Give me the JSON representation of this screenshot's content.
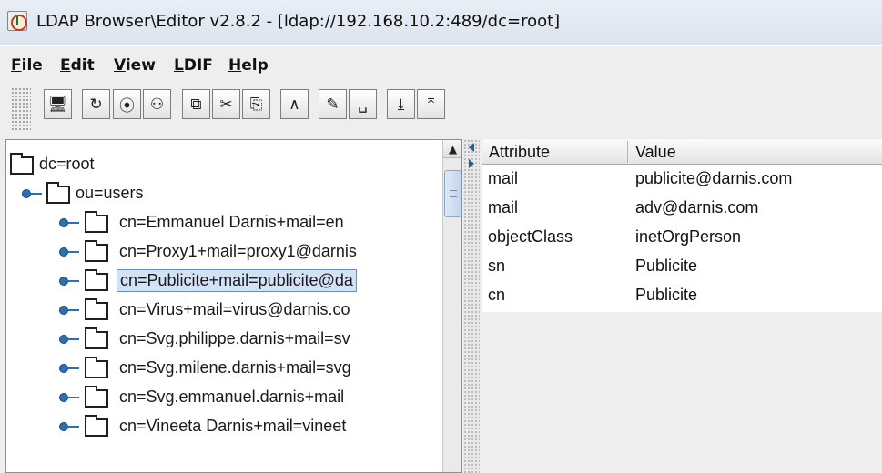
{
  "window": {
    "title": "LDAP Browser\\Editor v2.8.2 - [ldap://192.168.10.2:489/dc=root]"
  },
  "menu": [
    {
      "mnemonic": "F",
      "rest": "ile"
    },
    {
      "mnemonic": "E",
      "rest": "dit"
    },
    {
      "mnemonic": "V",
      "rest": "iew"
    },
    {
      "mnemonic": "L",
      "rest": "DIF"
    },
    {
      "mnemonic": "H",
      "rest": "elp"
    }
  ],
  "toolbar": {
    "buttons": [
      {
        "icon": "computer-icon",
        "glyph": "🖥"
      },
      {
        "icon": "refresh-icon",
        "glyph": "↻"
      },
      {
        "icon": "search-icon",
        "glyph": "⦿"
      },
      {
        "icon": "binoculars-icon",
        "glyph": "⚇"
      },
      {
        "icon": "copy-icon",
        "glyph": "⧉"
      },
      {
        "icon": "cut-icon",
        "glyph": "✂"
      },
      {
        "icon": "paste-icon",
        "glyph": "⎘"
      },
      {
        "icon": "up-icon",
        "glyph": "∧"
      },
      {
        "icon": "edit-icon",
        "glyph": "✎"
      },
      {
        "icon": "delete-icon",
        "glyph": "␣"
      },
      {
        "icon": "export-icon",
        "glyph": "⤓"
      },
      {
        "icon": "import-icon",
        "glyph": "⤒"
      }
    ]
  },
  "tree": {
    "root": "dc=root",
    "ou": "ou=users",
    "entries": [
      "cn=Emmanuel Darnis+mail=en",
      "cn=Proxy1+mail=proxy1@darnis",
      "cn=Publicite+mail=publicite@da",
      "cn=Virus+mail=virus@darnis.co",
      "cn=Svg.philippe.darnis+mail=sv",
      "cn=Svg.milene.darnis+mail=svg",
      "cn=Svg.emmanuel.darnis+mail",
      "cn=Vineeta Darnis+mail=vineet"
    ],
    "selected_index": 2
  },
  "attributes": {
    "headers": {
      "attribute": "Attribute",
      "value": "Value"
    },
    "rows": [
      {
        "name": "mail",
        "value": "publicite@darnis.com"
      },
      {
        "name": "mail",
        "value": "adv@darnis.com"
      },
      {
        "name": "objectClass",
        "value": "inetOrgPerson"
      },
      {
        "name": "sn",
        "value": "Publicite"
      },
      {
        "name": "cn",
        "value": "Publicite"
      }
    ]
  },
  "colors": {
    "selection_bg": "#d4e2f7",
    "selection_border": "#6a8dc4",
    "tree_handle": "#2c6fb4"
  }
}
